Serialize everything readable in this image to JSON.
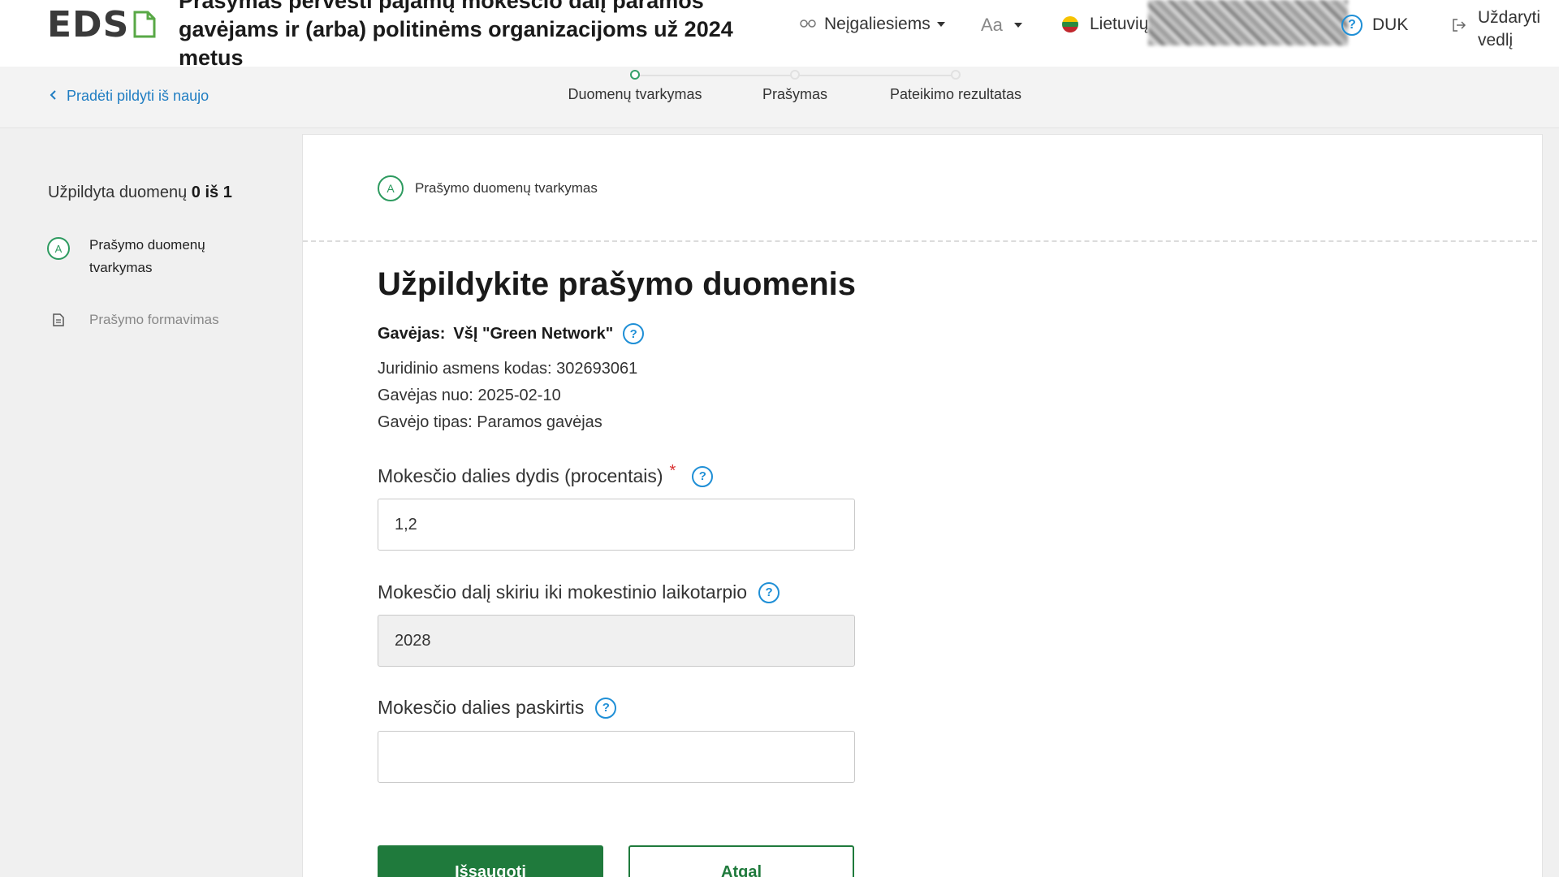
{
  "header": {
    "logo_text": "EDS",
    "title": "Prašymas pervesti pajamų mokesčio dalį paramos gavėjams ir (arba) politinėms organizacijoms už 2024 metus",
    "accessibility_label": "Neįgaliesiems",
    "font_size_label": "Aa",
    "language_label": "Lietuvių",
    "faq_label": "DUK",
    "close_label": "Uždaryti vedlį"
  },
  "subheader": {
    "restart_label": "Pradėti pildyti iš naujo",
    "steps": [
      {
        "label": "Duomenų tvarkymas",
        "active": true
      },
      {
        "label": "Prašymas",
        "active": false
      },
      {
        "label": "Pateikimo rezultatas",
        "active": false
      }
    ]
  },
  "sidebar": {
    "filled_prefix": "Užpildyta duomenų",
    "filled_count": "0 iš 1",
    "items": [
      {
        "badge": "A",
        "label": "Prašymo duomenų tvarkymas"
      },
      {
        "label": "Prašymo formavimas"
      }
    ]
  },
  "main": {
    "section_badge": "A",
    "section_title": "Prašymo duomenų tvarkymas",
    "heading": "Užpildykite prašymo duomenis",
    "recipient_label": "Gavėjas:",
    "recipient_name": "VšĮ \"Green Network\"",
    "info": {
      "code": "Juridinio asmens kodas: 302693061",
      "since": "Gavėjas nuo: 2025-02-10",
      "type": "Gavėjo tipas: Paramos gavėjas"
    },
    "fields": {
      "percent_label": "Mokesčio dalies dydis (procentais)",
      "percent_required": "*",
      "percent_value": "1,2",
      "period_label": "Mokesčio dalį skiriu iki mokestinio laikotarpio",
      "period_value": "2028",
      "purpose_label": "Mokesčio dalies paskirtis",
      "purpose_value": ""
    },
    "buttons": {
      "save": "Išsaugoti",
      "back": "Atgal"
    }
  },
  "colors": {
    "accent_green": "#1f7a3c",
    "badge_green": "#2d9a5f",
    "link_blue": "#1f7dc2",
    "help_blue": "#1f8fd6",
    "required_red": "#d93030"
  }
}
